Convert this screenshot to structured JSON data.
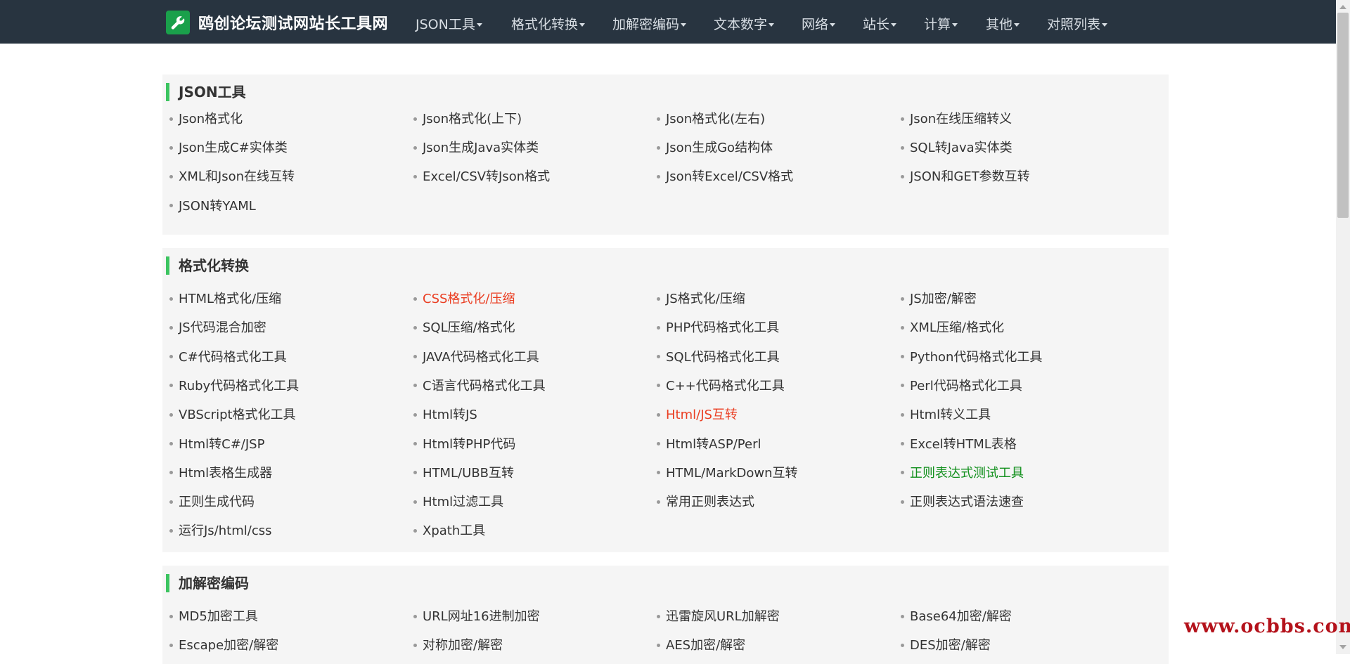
{
  "navbar": {
    "brand": "鸥创论坛测试网站长工具网",
    "items": [
      "JSON工具",
      "格式化转换",
      "加解密编码",
      "文本数字",
      "网络",
      "站长",
      "计算",
      "其他",
      "对照列表"
    ]
  },
  "sections": [
    {
      "title": "JSON工具",
      "items": [
        {
          "text": "Json格式化"
        },
        {
          "text": "Json格式化(上下)"
        },
        {
          "text": "Json格式化(左右)"
        },
        {
          "text": "Json在线压缩转义"
        },
        {
          "text": "Json生成C#实体类"
        },
        {
          "text": "Json生成Java实体类"
        },
        {
          "text": "Json生成Go结构体"
        },
        {
          "text": "SQL转Java实体类"
        },
        {
          "text": "XML和Json在线互转"
        },
        {
          "text": "Excel/CSV转Json格式"
        },
        {
          "text": "Json转Excel/CSV格式"
        },
        {
          "text": "JSON和GET参数互转"
        },
        {
          "text": "JSON转YAML"
        }
      ]
    },
    {
      "title": "格式化转换",
      "items": [
        {
          "text": "HTML格式化/压缩"
        },
        {
          "text": "CSS格式化/压缩",
          "color": "#ea3e22"
        },
        {
          "text": "JS格式化/压缩"
        },
        {
          "text": "JS加密/解密"
        },
        {
          "text": "JS代码混合加密"
        },
        {
          "text": "SQL压缩/格式化"
        },
        {
          "text": "PHP代码格式化工具"
        },
        {
          "text": "XML压缩/格式化"
        },
        {
          "text": "C#代码格式化工具"
        },
        {
          "text": "JAVA代码格式化工具"
        },
        {
          "text": "SQL代码格式化工具"
        },
        {
          "text": "Python代码格式化工具"
        },
        {
          "text": "Ruby代码格式化工具"
        },
        {
          "text": "C语言代码格式化工具"
        },
        {
          "text": "C++代码格式化工具"
        },
        {
          "text": "Perl代码格式化工具"
        },
        {
          "text": "VBScript格式化工具"
        },
        {
          "text": "Html转JS"
        },
        {
          "text": "Html/JS互转",
          "color": "#ea3e22"
        },
        {
          "text": "Html转义工具"
        },
        {
          "text": "Html转C#/JSP"
        },
        {
          "text": "Html转PHP代码"
        },
        {
          "text": "Html转ASP/Perl"
        },
        {
          "text": "Excel转HTML表格"
        },
        {
          "text": "Html表格生成器"
        },
        {
          "text": "HTML/UBB互转"
        },
        {
          "text": "HTML/MarkDown互转"
        },
        {
          "text": "正则表达式测试工具",
          "color": "#12901d"
        },
        {
          "text": "正则生成代码"
        },
        {
          "text": "Html过滤工具"
        },
        {
          "text": "常用正则表达式"
        },
        {
          "text": "正则表达式语法速查"
        },
        {
          "text": "运行Js/html/css"
        },
        {
          "text": "Xpath工具"
        }
      ]
    },
    {
      "title": "加解密编码",
      "items": [
        {
          "text": "MD5加密工具"
        },
        {
          "text": "URL网址16进制加密"
        },
        {
          "text": "迅雷旋风URL加解密"
        },
        {
          "text": "Base64加密/解密"
        },
        {
          "text": "Escape加密/解密"
        },
        {
          "text": "对称加密/解密"
        },
        {
          "text": "AES加密/解密"
        },
        {
          "text": "DES加密/解密"
        }
      ]
    }
  ],
  "watermark": "www.ocbbs.com",
  "colors": {
    "navbar_bg": "#283440",
    "brand_logo": "#1aa04b",
    "section_accent": "#3cc460",
    "link_red": "#ea3e22",
    "link_green": "#12901d",
    "watermark": "#b4121b"
  },
  "icons": {
    "brand": "wrench-icon",
    "nav_dropdown": "caret-down-icon",
    "scroll_up": "scroll-up-arrow-icon",
    "scroll_down": "scroll-down-arrow-icon"
  }
}
